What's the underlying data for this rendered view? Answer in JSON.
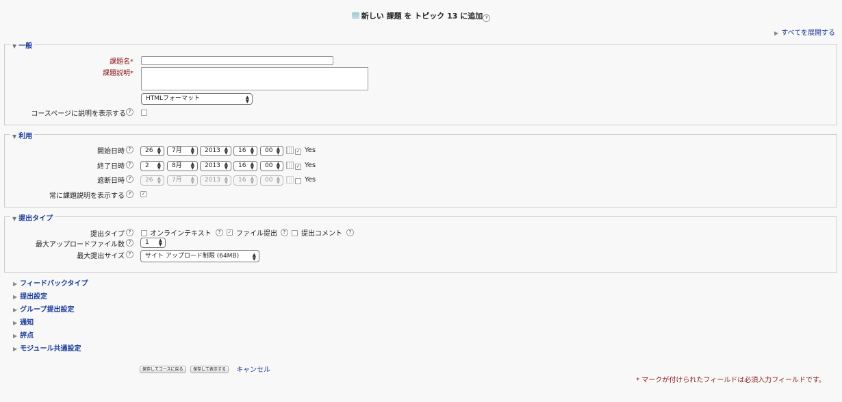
{
  "page": {
    "title_prefix": "新しい",
    "title_module": "課題",
    "title_mid": "を トピック",
    "title_topic": "13",
    "title_suffix": "に追加",
    "expand_all": "すべてを展開する"
  },
  "general": {
    "legend": "一般",
    "name_label": "課題名",
    "desc_label": "課題説明",
    "required_mark": "*",
    "name_value": "",
    "desc_value": "",
    "format_value": "HTMLフォーマット",
    "show_desc_label": "コースページに説明を表示する",
    "show_desc_checked": false
  },
  "availability": {
    "legend": "利用",
    "rows": [
      {
        "label": "開始日時",
        "day": "26",
        "month": "7月",
        "year": "2013",
        "hour": "16",
        "minute": "00",
        "enable": "Yes",
        "checked": true,
        "disabled": false
      },
      {
        "label": "終了日時",
        "day": "2",
        "month": "8月",
        "year": "2013",
        "hour": "16",
        "minute": "00",
        "enable": "Yes",
        "checked": true,
        "disabled": false
      },
      {
        "label": "遮断日時",
        "day": "26",
        "month": "7月",
        "year": "2013",
        "hour": "16",
        "minute": "00",
        "enable": "Yes",
        "checked": false,
        "disabled": true
      }
    ],
    "always_show_label": "常に課題説明を表示する",
    "always_show_checked": true
  },
  "submission": {
    "legend": "提出タイプ",
    "types_label": "提出タイプ",
    "online_text": "オンラインテキスト",
    "online_checked": false,
    "file_submission": "ファイル提出",
    "file_checked": true,
    "comments": "提出コメント",
    "comments_checked": false,
    "max_files_label": "最大アップロードファイル数",
    "max_files_value": "1",
    "max_size_label": "最大提出サイズ",
    "max_size_value": "サイト アップロード制限 (64MB)"
  },
  "collapsed_sections": [
    "フィードバックタイプ",
    "提出設定",
    "グループ提出設定",
    "通知",
    "評点",
    "モジュール共通設定"
  ],
  "buttons": {
    "save_return": "保存してコースに戻る",
    "save_display": "保存して表示する",
    "cancel": "キャンセル"
  },
  "required_note": "マークが付けられたフィールドは必須入力フィールドです。"
}
